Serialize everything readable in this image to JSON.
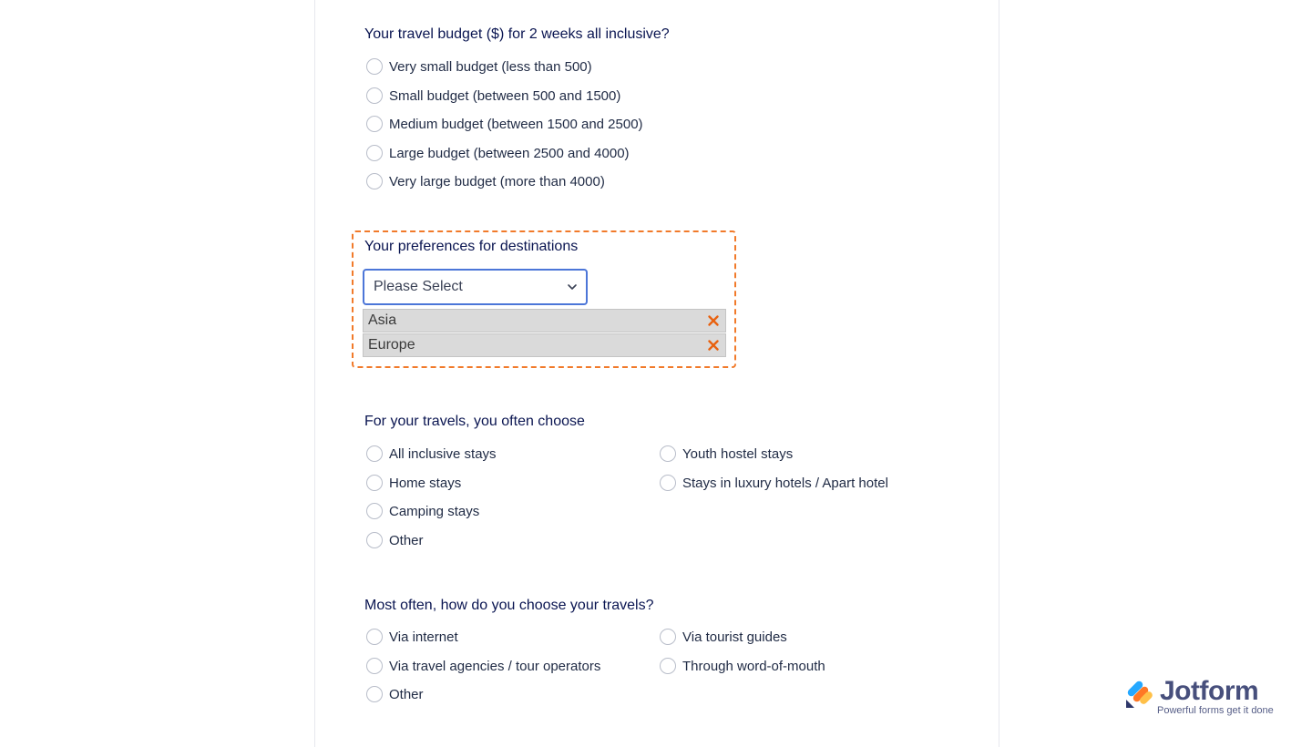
{
  "budget": {
    "question": "Your travel budget ($) for 2 weeks all inclusive?",
    "options": [
      "Very small budget (less than 500)",
      "Small budget (between 500 and 1500)",
      "Medium budget (between 1500 and 2500)",
      "Large budget (between 2500 and 4000)",
      "Very large budget (more than 4000)"
    ]
  },
  "destinations": {
    "question": "Your preferences for destinations",
    "select_value": "Please Select",
    "selected_tags": [
      "Asia",
      "Europe"
    ]
  },
  "stays": {
    "question": "For your travels, you often choose",
    "options": [
      "All inclusive stays",
      "Youth hostel stays",
      "Home stays",
      "Stays in luxury hotels / Apart hotel",
      "Camping stays",
      "Other"
    ]
  },
  "choose": {
    "question": "Most often, how do you choose your travels?",
    "options": [
      "Via internet",
      "Via tourist guides",
      "Via travel agencies / tour operators",
      "Through word-of-mouth",
      "Other"
    ]
  },
  "branding": {
    "name": "Jotform",
    "tagline": "Powerful forms get it done"
  },
  "colors": {
    "accent_focus": "#f17a2a",
    "select_border": "#4c76d8",
    "remove_icon": "#e8610f",
    "label_text": "#0a1551"
  },
  "icons": {
    "select_arrow": "chevron-down-icon",
    "tag_remove": "close-icon",
    "brand": "jotform-logo-icon"
  }
}
